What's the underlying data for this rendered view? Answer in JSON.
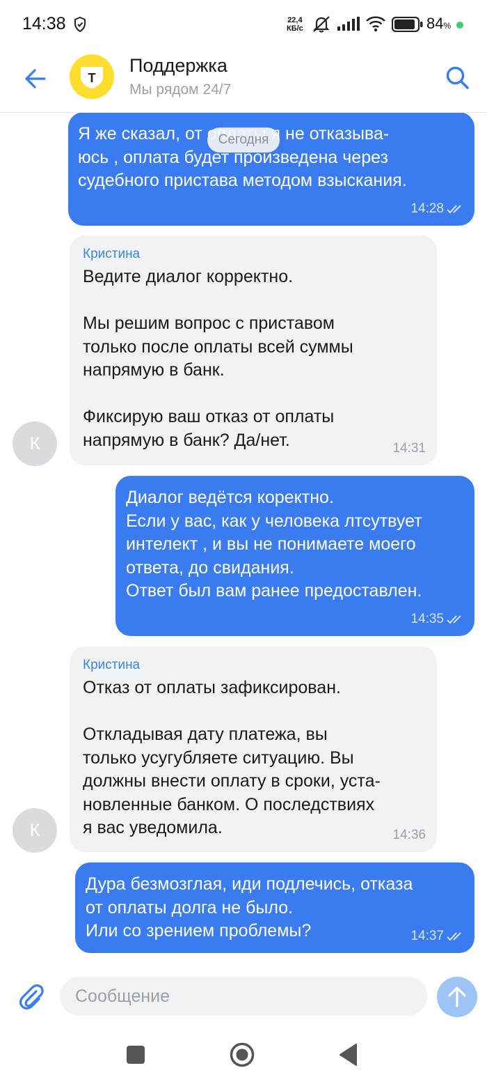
{
  "status_bar": {
    "time": "14:38",
    "net_speed_value": "22,4",
    "net_speed_unit": "КБ/с",
    "battery_percent": "84",
    "battery_sign": "%"
  },
  "header": {
    "title": "Поддержка",
    "subtitle": "Мы рядом 24/7",
    "logo_letter": "Т"
  },
  "date_pill": "Сегодня",
  "messages": [
    {
      "direction": "out",
      "text": "Я же сказал, от оплаты я не отказыва-\nюсь , оплата будет произведена через\nсудебного пристава методом взыскания.",
      "time": "14:28"
    },
    {
      "direction": "in",
      "sender": "Кристина",
      "text": "Ведите диалог корректно.\n\nМы решим вопрос с приставом\nтолько после оплаты всей суммы\nнапрямую в банк.\n\nФиксирую ваш отказ от оплаты\nнапрямую в банк? Да/нет.",
      "time": "14:31",
      "avatar_letter": "К"
    },
    {
      "direction": "out",
      "text": "Диалог ведётся коректно.\nЕсли у вас, как у человека лтсутвует\nинтелект , и вы не понимаете моего\nответа, до свидания.\nОтвет был вам ранее предоставлен.",
      "time": "14:35"
    },
    {
      "direction": "in",
      "sender": "Кристина",
      "text": "Отказ от оплаты зафиксирован.\n\nОткладывая дату платежа, вы\nтолько усугубляете ситуацию. Вы\nдолжны внести оплату в сроки, уста-\nновленные банком. О последствиях\nя вас уведомила.",
      "time": "14:36",
      "avatar_letter": "К"
    },
    {
      "direction": "out",
      "text": "Дура безмозглая, иди подлечись, отказа\nот оплаты долга не было.\nИли со зрением проблемы?",
      "time": "14:37"
    }
  ],
  "composer": {
    "placeholder": "Сообщение"
  },
  "colors": {
    "outgoing_bubble": "#3a7bf0",
    "incoming_bubble": "#f1f2f4",
    "accent": "#3a86d8",
    "logo_yellow": "#ffdd2d",
    "send_button": "#9ec4f5"
  },
  "icons": [
    "shield-icon",
    "mute-icon",
    "signal-icon",
    "wifi-icon",
    "battery-icon",
    "back-arrow-icon",
    "search-icon",
    "read-ticks-icon",
    "paperclip-icon",
    "send-arrow-icon",
    "nav-recents-icon",
    "nav-home-icon",
    "nav-back-icon"
  ]
}
